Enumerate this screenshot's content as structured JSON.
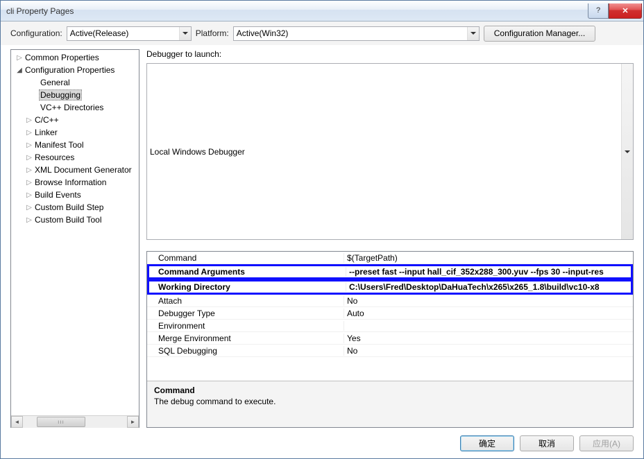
{
  "window": {
    "title": "cli Property Pages"
  },
  "toolbar": {
    "config_label": "Configuration:",
    "config_value": "Active(Release)",
    "platform_label": "Platform:",
    "platform_value": "Active(Win32)",
    "config_manager": "Configuration Manager..."
  },
  "tree": {
    "items": [
      {
        "label": "Common Properties",
        "indent": 0,
        "arrow": "collapsed"
      },
      {
        "label": "Configuration Properties",
        "indent": 0,
        "arrow": "expanded"
      },
      {
        "label": "General",
        "indent": 2,
        "arrow": "none"
      },
      {
        "label": "Debugging",
        "indent": 2,
        "arrow": "none",
        "selected": true
      },
      {
        "label": "VC++ Directories",
        "indent": 2,
        "arrow": "none"
      },
      {
        "label": "C/C++",
        "indent": 1,
        "arrow": "collapsed"
      },
      {
        "label": "Linker",
        "indent": 1,
        "arrow": "collapsed"
      },
      {
        "label": "Manifest Tool",
        "indent": 1,
        "arrow": "collapsed"
      },
      {
        "label": "Resources",
        "indent": 1,
        "arrow": "collapsed"
      },
      {
        "label": "XML Document Generator",
        "indent": 1,
        "arrow": "collapsed"
      },
      {
        "label": "Browse Information",
        "indent": 1,
        "arrow": "collapsed"
      },
      {
        "label": "Build Events",
        "indent": 1,
        "arrow": "collapsed"
      },
      {
        "label": "Custom Build Step",
        "indent": 1,
        "arrow": "collapsed"
      },
      {
        "label": "Custom Build Tool",
        "indent": 1,
        "arrow": "collapsed"
      }
    ]
  },
  "launcher": {
    "label": "Debugger to launch:",
    "value": "Local Windows Debugger"
  },
  "props": [
    {
      "name": "Command",
      "value": "$(TargetPath)",
      "highlight": false
    },
    {
      "name": "Command Arguments",
      "value": "--preset fast --input hall_cif_352x288_300.yuv --fps 30 --input-res",
      "highlight": true
    },
    {
      "name": "Working Directory",
      "value": "C:\\Users\\Fred\\Desktop\\DaHuaTech\\x265\\x265_1.8\\build\\vc10-x8",
      "highlight": true
    },
    {
      "name": "Attach",
      "value": "No",
      "highlight": false
    },
    {
      "name": "Debugger Type",
      "value": "Auto",
      "highlight": false
    },
    {
      "name": "Environment",
      "value": "",
      "highlight": false
    },
    {
      "name": "Merge Environment",
      "value": "Yes",
      "highlight": false
    },
    {
      "name": "SQL Debugging",
      "value": "No",
      "highlight": false
    }
  ],
  "description": {
    "title": "Command",
    "text": "The debug command to execute."
  },
  "buttons": {
    "ok": "确定",
    "cancel": "取消",
    "apply": "应用(A)"
  }
}
